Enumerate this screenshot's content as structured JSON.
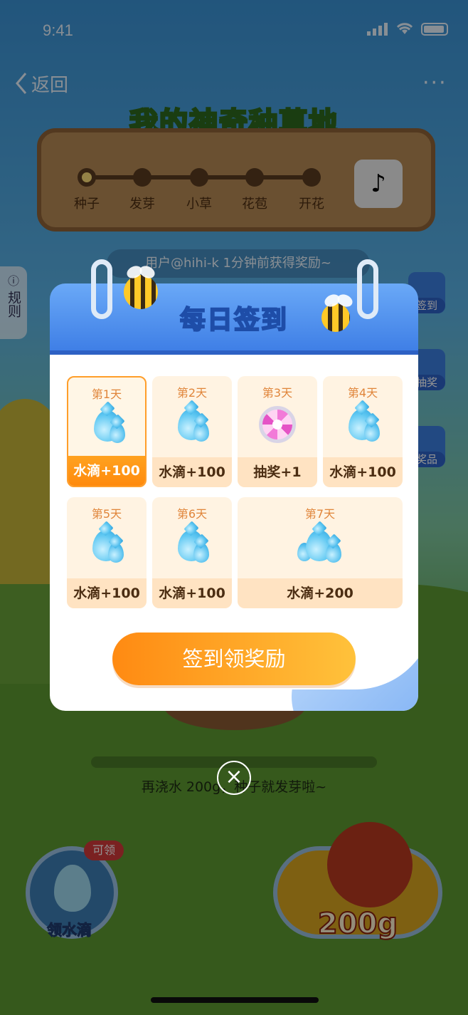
{
  "status_bar": {
    "time": "9:41"
  },
  "nav": {
    "back_label": "返回",
    "more_label": "···"
  },
  "garden": {
    "title": "我的神奇种草地",
    "stages": [
      "种子",
      "发芽",
      "小草",
      "花苞",
      "开花"
    ],
    "active_stage_index": 0,
    "ticker": "用户@hihi-k 1分钟前获得奖励~",
    "rule_label": "规则",
    "hint": "再浇水 200g，种子就发芽啦~",
    "side_badges": [
      "签到",
      "抽奖",
      "奖品"
    ],
    "water_button_label": "领水滴",
    "water_tag": "可领",
    "can_amount": "200g"
  },
  "checkin_modal": {
    "title": "每日签到",
    "days": [
      {
        "label": "第1天",
        "reward": "水滴+100",
        "icon": "water-drop-icon",
        "active": true
      },
      {
        "label": "第2天",
        "reward": "水滴+100",
        "icon": "water-drop-icon",
        "active": false
      },
      {
        "label": "第3天",
        "reward": "抽奖+1",
        "icon": "lottery-wheel-icon",
        "active": false
      },
      {
        "label": "第4天",
        "reward": "水滴+100",
        "icon": "water-drop-icon",
        "active": false
      },
      {
        "label": "第5天",
        "reward": "水滴+100",
        "icon": "water-drop-icon",
        "active": false
      },
      {
        "label": "第6天",
        "reward": "水滴+100",
        "icon": "water-drop-icon",
        "active": false
      },
      {
        "label": "第7天",
        "reward": "水滴+200",
        "icon": "water-drops-icon",
        "active": false
      }
    ],
    "claim_button": "签到领奖励",
    "close_icon": "×"
  },
  "colors": {
    "accent_orange": "#ff8a0d",
    "header_blue": "#3f7fe6",
    "cell_bg": "#fff3e2",
    "day_text": "#e0853a"
  }
}
